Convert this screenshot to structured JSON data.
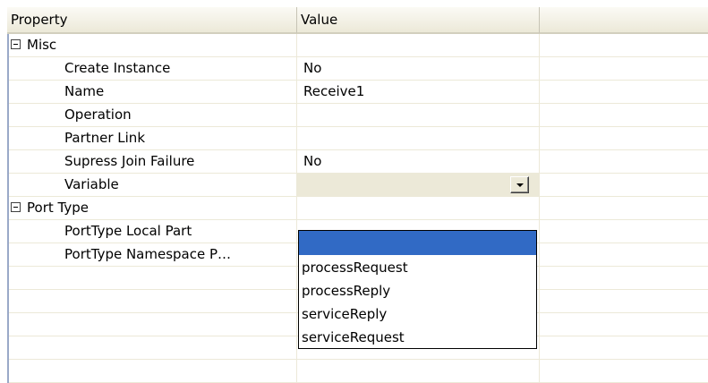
{
  "header": {
    "property": "Property",
    "value": "Value"
  },
  "categories": [
    {
      "label": "Misc",
      "expanded": true,
      "properties": [
        {
          "name": "Create Instance",
          "value": "No"
        },
        {
          "name": "Name",
          "value": "Receive1"
        },
        {
          "name": "Operation",
          "value": ""
        },
        {
          "name": "Partner Link",
          "value": ""
        },
        {
          "name": "Supress Join Failure",
          "value": "No"
        },
        {
          "name": "Variable",
          "value": ""
        }
      ]
    },
    {
      "label": "Port Type",
      "expanded": true,
      "properties": [
        {
          "name": "PortType Local Part",
          "value": ""
        },
        {
          "name": "PortType Namespace P…",
          "value": ""
        }
      ]
    }
  ],
  "dropdown": {
    "options": [
      "",
      "processRequest",
      "processReply",
      "serviceReply",
      "serviceRequest"
    ],
    "highlighted_index": 0
  },
  "icons": {
    "collapse": "minus-box-icon",
    "combo": "chevron-down-icon"
  },
  "colors": {
    "highlight": "#316ac5",
    "grid_line": "#ece9d8",
    "header": "#ece9d8"
  }
}
